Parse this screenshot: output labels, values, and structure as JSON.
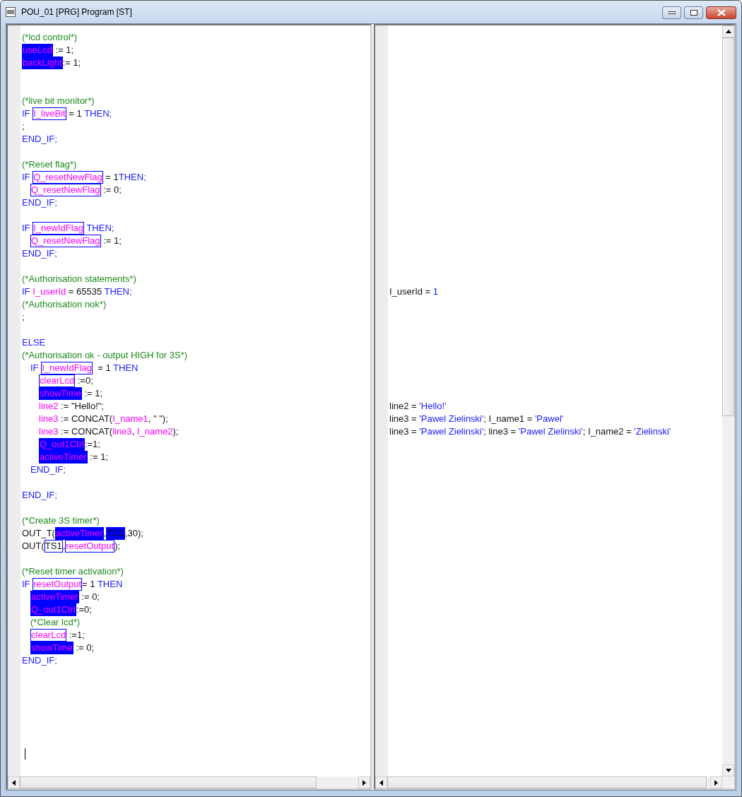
{
  "window": {
    "title": "POU_01 [PRG] Program [ST]"
  },
  "editor": {
    "lines": [
      {
        "kind": "code",
        "code": [
          {
            "text": "(*lcd control*)",
            "kind": "comment",
            "filled": false,
            "framed": false
          }
        ]
      },
      {
        "kind": "code",
        "code": [
          {
            "text": "useLcd",
            "kind": "var",
            "filled": true,
            "framed": false
          },
          {
            "text": " := 1;",
            "kind": "plain",
            "filled": false,
            "framed": false
          }
        ]
      },
      {
        "kind": "code",
        "code": [
          {
            "text": "backLight",
            "kind": "var",
            "filled": true,
            "framed": false
          },
          {
            "text": ":= 1;",
            "kind": "plain",
            "filled": false,
            "framed": false
          }
        ]
      },
      {
        "kind": "blank"
      },
      {
        "kind": "blank"
      },
      {
        "kind": "code",
        "code": [
          {
            "text": "(*live bit monitor*)",
            "kind": "comment",
            "filled": false,
            "framed": false
          }
        ]
      },
      {
        "kind": "code",
        "code": [
          {
            "text": "IF ",
            "kind": "kw",
            "filled": false,
            "framed": false
          },
          {
            "text": "I_liveBit",
            "kind": "var",
            "filled": false,
            "framed": true
          },
          {
            "text": " = 1",
            "kind": "plain",
            "filled": false,
            "framed": false
          },
          {
            "text": " THEN;",
            "kind": "kw",
            "filled": false,
            "framed": false
          }
        ]
      },
      {
        "kind": "code",
        "code": [
          {
            "text": ";",
            "kind": "plain",
            "filled": false,
            "framed": false
          }
        ]
      },
      {
        "kind": "code",
        "code": [
          {
            "text": "END_IF;",
            "kind": "kw",
            "filled": false,
            "framed": false
          }
        ]
      },
      {
        "kind": "blank"
      },
      {
        "kind": "code",
        "code": [
          {
            "text": "(*Reset flag*)",
            "kind": "comment",
            "filled": false,
            "framed": false
          }
        ]
      },
      {
        "kind": "code",
        "code": [
          {
            "text": "IF ",
            "kind": "kw",
            "filled": false,
            "framed": false
          },
          {
            "text": "Q_resetNewFlag",
            "kind": "var",
            "filled": false,
            "framed": true
          },
          {
            "text": " = 1",
            "kind": "plain",
            "filled": false,
            "framed": false
          },
          {
            "text": "THEN;",
            "kind": "kw",
            "filled": false,
            "framed": false
          }
        ],
        "children": [
          {
            "kind": "code",
            "code": [
              {
                "text": "Q_resetNewFlag",
                "kind": "var",
                "filled": false,
                "framed": true
              },
              {
                "text": " := 0;",
                "kind": "plain",
                "filled": false,
                "framed": false
              }
            ]
          }
        ]
      },
      {
        "kind": "code",
        "code": [
          {
            "text": "END_IF;",
            "kind": "kw",
            "filled": false,
            "framed": false
          }
        ]
      },
      {
        "kind": "blank"
      },
      {
        "kind": "code",
        "code": [
          {
            "text": "IF ",
            "kind": "kw",
            "filled": false,
            "framed": false
          },
          {
            "text": "I_newIdFlag",
            "kind": "var",
            "filled": false,
            "framed": true
          },
          {
            "text": " THEN;",
            "kind": "kw",
            "filled": false,
            "framed": false
          }
        ],
        "children": [
          {
            "kind": "code",
            "code": [
              {
                "text": "Q_resetNewFlag",
                "kind": "var",
                "filled": false,
                "framed": true
              },
              {
                "text": " := 1;",
                "kind": "plain",
                "filled": false,
                "framed": false
              }
            ]
          }
        ]
      },
      {
        "kind": "code",
        "code": [
          {
            "text": "END_IF;",
            "kind": "kw",
            "filled": false,
            "framed": false
          }
        ]
      },
      {
        "kind": "blank"
      },
      {
        "kind": "code",
        "code": [
          {
            "text": "(*Authorisation statements*)",
            "kind": "comment",
            "filled": false,
            "framed": false
          }
        ]
      },
      {
        "kind": "code",
        "code": [
          {
            "text": "IF ",
            "kind": "kw",
            "filled": false,
            "framed": false
          },
          {
            "text": "I_userId",
            "kind": "var",
            "filled": false,
            "framed": false
          },
          {
            "text": " = 65535",
            "kind": "plain",
            "filled": false,
            "framed": false
          },
          {
            "text": " THEN;",
            "kind": "kw",
            "filled": false,
            "framed": false
          }
        ],
        "monitor": [
          {
            "text": "I_userId = ",
            "kind": "plain",
            "filled": false,
            "framed": false
          },
          {
            "text": "1",
            "kind": "value",
            "filled": false,
            "framed": false
          }
        ]
      },
      {
        "kind": "code",
        "code": [
          {
            "text": "(*Authorisation nok*)",
            "kind": "comment",
            "filled": false,
            "framed": false
          }
        ]
      },
      {
        "kind": "code",
        "code": [
          {
            "text": ";",
            "kind": "plain",
            "filled": false,
            "framed": false
          }
        ]
      },
      {
        "kind": "blank"
      },
      {
        "kind": "code",
        "code": [
          {
            "text": "ELSE",
            "kind": "kw",
            "filled": false,
            "framed": false
          }
        ]
      },
      {
        "kind": "code",
        "code": [
          {
            "text": "(*Authorisation ok - output HIGH for 3S*)",
            "kind": "comment",
            "filled": false,
            "framed": false
          }
        ],
        "children": [
          {
            "kind": "code",
            "code": [
              {
                "text": "IF ",
                "kind": "kw",
                "filled": false,
                "framed": false
              },
              {
                "text": "I_newIdFlag",
                "kind": "var",
                "filled": false,
                "framed": true
              },
              {
                "text": "  = 1",
                "kind": "plain",
                "filled": false,
                "framed": false
              },
              {
                "text": " THEN",
                "kind": "kw",
                "filled": false,
                "framed": false
              }
            ],
            "children": [
              {
                "kind": "code",
                "code": [
                  {
                    "text": "clearLcd",
                    "kind": "var",
                    "filled": false,
                    "framed": true
                  },
                  {
                    "text": " :=0;",
                    "kind": "plain",
                    "filled": false,
                    "framed": false
                  }
                ]
              },
              {
                "kind": "code",
                "code": [
                  {
                    "text": "showTime",
                    "kind": "var",
                    "filled": true,
                    "framed": false
                  },
                  {
                    "text": " := 1;",
                    "kind": "plain",
                    "filled": false,
                    "framed": false
                  }
                ]
              },
              {
                "kind": "code",
                "code": [
                  {
                    "text": "line2",
                    "kind": "var",
                    "filled": false,
                    "framed": false
                  },
                  {
                    "text": " := \"Hello!\";",
                    "kind": "plain",
                    "filled": false,
                    "framed": false
                  }
                ],
                "monitor": [
                  {
                    "text": "line2 = ",
                    "kind": "plain",
                    "filled": false,
                    "framed": false
                  },
                  {
                    "text": "'Hello!'",
                    "kind": "value",
                    "filled": false,
                    "framed": false
                  }
                ]
              },
              {
                "kind": "code",
                "code": [
                  {
                    "text": "line3",
                    "kind": "var",
                    "filled": false,
                    "framed": false
                  },
                  {
                    "text": " := CONCAT(",
                    "kind": "plain",
                    "filled": false,
                    "framed": false
                  },
                  {
                    "text": "I_name1",
                    "kind": "var",
                    "filled": false,
                    "framed": false
                  },
                  {
                    "text": ", \" \");",
                    "kind": "plain",
                    "filled": false,
                    "framed": false
                  }
                ],
                "monitor": [
                  {
                    "text": "line3 = ",
                    "kind": "plain",
                    "filled": false,
                    "framed": false
                  },
                  {
                    "text": "'Pawel Zielinski'",
                    "kind": "value",
                    "filled": false,
                    "framed": false
                  },
                  {
                    "text": "; I_name1 = ",
                    "kind": "plain",
                    "filled": false,
                    "framed": false
                  },
                  {
                    "text": "'Pawel'",
                    "kind": "value",
                    "filled": false,
                    "framed": false
                  }
                ]
              },
              {
                "kind": "code",
                "code": [
                  {
                    "text": "line3",
                    "kind": "var",
                    "filled": false,
                    "framed": false
                  },
                  {
                    "text": " := CONCAT(",
                    "kind": "plain",
                    "filled": false,
                    "framed": false
                  },
                  {
                    "text": "line3",
                    "kind": "var",
                    "filled": false,
                    "framed": false
                  },
                  {
                    "text": ", ",
                    "kind": "plain",
                    "filled": false,
                    "framed": false
                  },
                  {
                    "text": "I_name2",
                    "kind": "var",
                    "filled": false,
                    "framed": false
                  },
                  {
                    "text": ");",
                    "kind": "plain",
                    "filled": false,
                    "framed": false
                  }
                ],
                "monitor": [
                  {
                    "text": "line3 = ",
                    "kind": "plain",
                    "filled": false,
                    "framed": false
                  },
                  {
                    "text": "'Pawel Zielinski'",
                    "kind": "value",
                    "filled": false,
                    "framed": false
                  },
                  {
                    "text": "; line3 = ",
                    "kind": "plain",
                    "filled": false,
                    "framed": false
                  },
                  {
                    "text": "'Pawel Zielinski'",
                    "kind": "value",
                    "filled": false,
                    "framed": false
                  },
                  {
                    "text": "; I_name2 = ",
                    "kind": "plain",
                    "filled": false,
                    "framed": false
                  },
                  {
                    "text": "'Zielinski'",
                    "kind": "value",
                    "filled": false,
                    "framed": false
                  }
                ]
              },
              {
                "kind": "code",
                "code": [
                  {
                    "text": "Q_out1Ctrl",
                    "kind": "var",
                    "filled": true,
                    "framed": false
                  },
                  {
                    "text": ":=1;",
                    "kind": "plain",
                    "filled": false,
                    "framed": false
                  }
                ]
              },
              {
                "kind": "code",
                "code": [
                  {
                    "text": "activeTimer",
                    "kind": "var",
                    "filled": true,
                    "framed": false
                  },
                  {
                    "text": " := 1;",
                    "kind": "plain",
                    "filled": false,
                    "framed": false
                  }
                ]
              }
            ]
          },
          {
            "kind": "code",
            "code": [
              {
                "text": "END_IF;",
                "kind": "kw",
                "filled": false,
                "framed": false
              }
            ]
          }
        ]
      },
      {
        "kind": "blank"
      },
      {
        "kind": "code",
        "code": [
          {
            "text": "END_IF;",
            "kind": "kw",
            "filled": false,
            "framed": false
          }
        ]
      },
      {
        "kind": "blank"
      },
      {
        "kind": "code",
        "code": [
          {
            "text": "(*Create 3S timer*)",
            "kind": "comment",
            "filled": false,
            "framed": false
          }
        ]
      },
      {
        "kind": "code",
        "code": [
          {
            "text": "OUT_T(",
            "kind": "plain",
            "filled": false,
            "framed": false
          },
          {
            "text": "activeTimer",
            "kind": "var",
            "filled": true,
            "framed": false
          },
          {
            "text": ",",
            "kind": "plain",
            "filled": false,
            "framed": false
          },
          {
            "text": "TC1",
            "kind": "plain",
            "filled": true,
            "framed": false
          },
          {
            "text": ",30);",
            "kind": "plain",
            "filled": false,
            "framed": false
          }
        ]
      },
      {
        "kind": "code",
        "code": [
          {
            "text": "OUT(",
            "kind": "plain",
            "filled": false,
            "framed": false
          },
          {
            "text": "TS1",
            "kind": "plain",
            "filled": false,
            "framed": true
          },
          {
            "text": ",",
            "kind": "plain",
            "filled": false,
            "framed": false
          },
          {
            "text": "resetOutput",
            "kind": "var",
            "filled": false,
            "framed": true
          },
          {
            "text": ");",
            "kind": "plain",
            "filled": false,
            "framed": false
          }
        ]
      },
      {
        "kind": "blank"
      },
      {
        "kind": "code",
        "code": [
          {
            "text": "(*Reset timer activation*)",
            "kind": "comment",
            "filled": false,
            "framed": false
          }
        ]
      },
      {
        "kind": "code",
        "code": [
          {
            "text": "IF ",
            "kind": "kw",
            "filled": false,
            "framed": false
          },
          {
            "text": "resetOutput",
            "kind": "var",
            "filled": false,
            "framed": true
          },
          {
            "text": "= 1",
            "kind": "plain",
            "filled": false,
            "framed": false
          },
          {
            "text": " THEN",
            "kind": "kw",
            "filled": false,
            "framed": false
          }
        ],
        "children": [
          {
            "kind": "code",
            "code": [
              {
                "text": "activeTimer",
                "kind": "var",
                "filled": true,
                "framed": false
              },
              {
                "text": " := 0;",
                "kind": "plain",
                "filled": false,
                "framed": false
              }
            ]
          },
          {
            "kind": "code",
            "code": [
              {
                "text": "Q_out1Ctrl",
                "kind": "var",
                "filled": true,
                "framed": false
              },
              {
                "text": ":=0;",
                "kind": "plain",
                "filled": false,
                "framed": false
              }
            ]
          },
          {
            "kind": "code",
            "code": [
              {
                "text": "(*Clear lcd*)",
                "kind": "comment",
                "filled": false,
                "framed": false
              }
            ]
          },
          {
            "kind": "code",
            "code": [
              {
                "text": "clearLcd",
                "kind": "var",
                "filled": false,
                "framed": true
              },
              {
                "text": " :=1;",
                "kind": "plain",
                "filled": false,
                "framed": false
              }
            ]
          },
          {
            "kind": "code",
            "code": [
              {
                "text": "showTime",
                "kind": "var",
                "filled": true,
                "framed": false
              },
              {
                "text": " := 0;",
                "kind": "plain",
                "filled": false,
                "framed": false
              }
            ]
          }
        ]
      },
      {
        "kind": "code",
        "code": [
          {
            "text": "END_IF;",
            "kind": "kw",
            "filled": false,
            "framed": false
          }
        ]
      }
    ]
  }
}
